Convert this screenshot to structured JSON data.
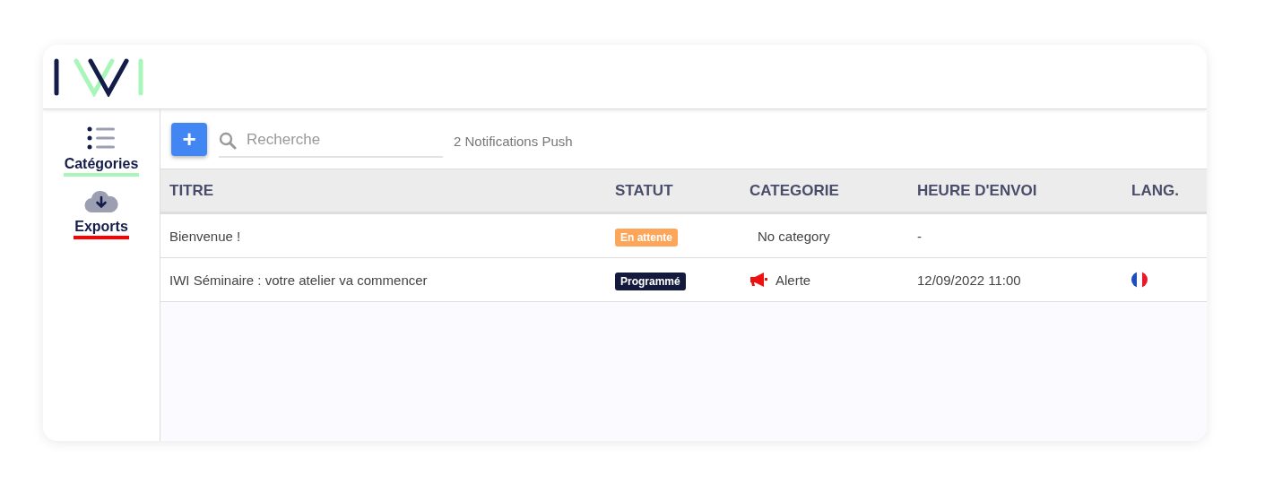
{
  "sidebar": {
    "items": [
      {
        "label": "Catégories",
        "kind": "list",
        "color": "#aaf5b9"
      },
      {
        "label": "Exports",
        "kind": "cloud",
        "color": "#ff0000"
      }
    ]
  },
  "toolbar": {
    "add_button": "+",
    "search": {
      "placeholder": "Recherche"
    },
    "count": "2 Notifications Push"
  },
  "table": {
    "columns": [
      "TITRE",
      "STATUT",
      "CATEGORIE",
      "HEURE D'ENVOI",
      "LANG."
    ],
    "rows": [
      {
        "title": "Bienvenue !",
        "status": {
          "label": "En attente",
          "color": "#fda659"
        },
        "category": {
          "label": "No category",
          "kind": "none"
        },
        "sent": "-",
        "flag": false
      },
      {
        "title": "IWI Séminaire : votre atelier va commencer",
        "status": {
          "label": "Programmé",
          "color": "#141a3d"
        },
        "category": {
          "label": "Alerte",
          "kind": "alert"
        },
        "sent": "12/09/2022 11:00",
        "flag": true
      }
    ]
  }
}
